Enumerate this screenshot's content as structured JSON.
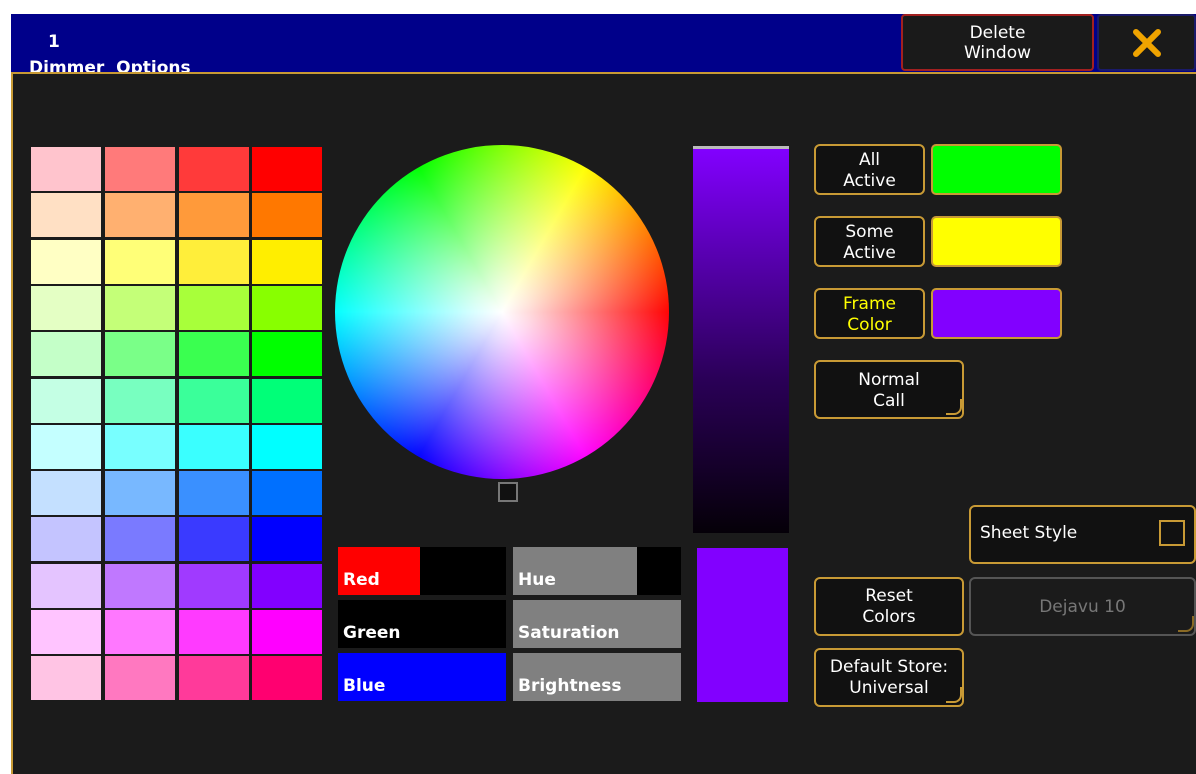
{
  "title": {
    "number": "1",
    "text": "Dimmer  Options"
  },
  "header_buttons": {
    "delete_window": "Delete\nWindow",
    "close_icon": "close-icon"
  },
  "palette": [
    [
      "#ffc4cd",
      "#ff7a7a",
      "#ff3a3a",
      "#ff0000"
    ],
    [
      "#ffe0c4",
      "#ffb070",
      "#ff9a3a",
      "#ff7800"
    ],
    [
      "#ffffc4",
      "#ffff78",
      "#ffee3a",
      "#ffee00"
    ],
    [
      "#e4ffc4",
      "#c4ff78",
      "#a8ff3a",
      "#88ff00"
    ],
    [
      "#c4ffc8",
      "#7aff88",
      "#3aff50",
      "#00ff00"
    ],
    [
      "#c4ffe4",
      "#78ffc0",
      "#3aff9a",
      "#00ff78"
    ],
    [
      "#c4ffff",
      "#78ffff",
      "#3affff",
      "#00ffff"
    ],
    [
      "#c4e0ff",
      "#78b8ff",
      "#3a90ff",
      "#0070ff"
    ],
    [
      "#c4c4ff",
      "#7a7aff",
      "#3a3aff",
      "#0000ff"
    ],
    [
      "#e4c4ff",
      "#c078ff",
      "#a03aff",
      "#8200ff"
    ],
    [
      "#ffc4ff",
      "#ff78ff",
      "#ff3aff",
      "#ff00ff"
    ],
    [
      "#ffc4e4",
      "#ff78c0",
      "#ff3a9a",
      "#ff0070"
    ]
  ],
  "sliders": [
    {
      "label": "Red",
      "fill_fraction": 0.49,
      "color": "#ff0000",
      "bg": "#000000"
    },
    {
      "label": "Green",
      "fill_fraction": 0,
      "color": "#00c000",
      "bg": "#000000"
    },
    {
      "label": "Blue",
      "fill_fraction": 1,
      "color": "#0000ff",
      "bg": "#000000"
    },
    {
      "label": "Hue",
      "fill_fraction": 0.74,
      "color": "#808080",
      "bg": "#000000"
    },
    {
      "label": "Saturation",
      "fill_fraction": 1,
      "color": "#808080",
      "bg": "#000000"
    },
    {
      "label": "Brightness",
      "fill_fraction": 1,
      "color": "#808080",
      "bg": "#000000"
    }
  ],
  "buttons": {
    "all_active": "All\nActive",
    "some_active": "Some\nActive",
    "frame_color": "Frame\nColor",
    "normal_call": "Normal\nCall",
    "sheet_style": "Sheet Style",
    "reset_colors": "Reset\nColors",
    "font": "Dejavu 10",
    "default_store": "Default Store:\nUniversal"
  },
  "colors": {
    "all_active": "#00ff00",
    "some_active": "#ffff00",
    "frame_color": "#8200ff",
    "accent": "#c89a35",
    "title_bar": "#00008a"
  }
}
